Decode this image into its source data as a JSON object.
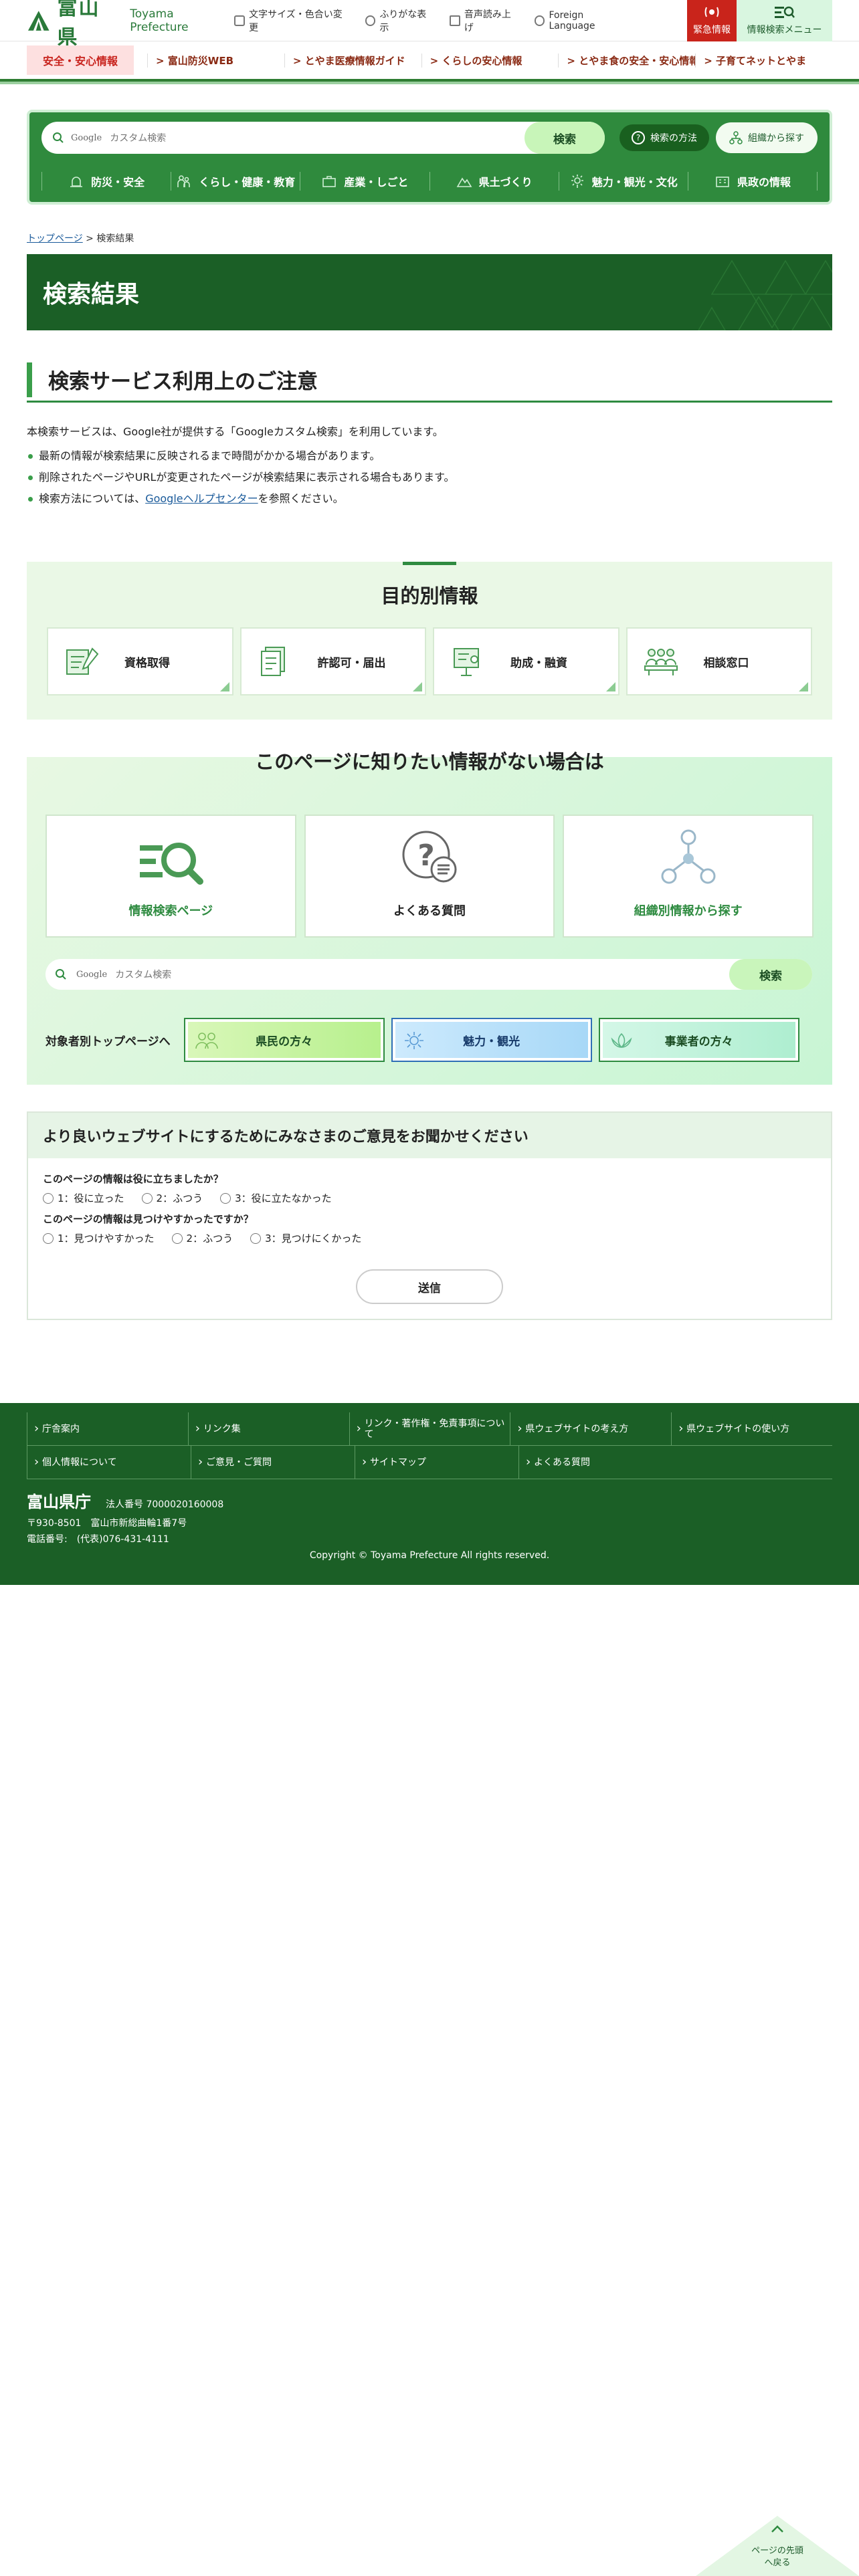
{
  "header": {
    "logo_ja": "富山県",
    "logo_en": "Toyama Prefecture",
    "utility": [
      "文字サイズ・色合い変更",
      "ふりがな表示",
      "音声読み上げ",
      "Foreign Language"
    ],
    "emergency": "緊急情報",
    "menu": "情報検索メニュー"
  },
  "safety": {
    "label": "安全・安心情報",
    "links": [
      "> 富山防災WEB",
      "> とやま医療情報ガイド",
      "> くらしの安心情報",
      "> とやま食の安全・安心情報",
      "> 子育てネットとやま"
    ]
  },
  "search": {
    "placeholder": "カスタム検索",
    "brand": "Google",
    "button": "検索",
    "howto": "検索の方法",
    "org": "組織から探す"
  },
  "gnav": [
    "防災・安全",
    "くらし・健康・教育",
    "産業・しごと",
    "県土づくり",
    "魅力・観光・文化",
    "県政の情報"
  ],
  "breadcrumb": {
    "top": "トップページ",
    "sep": " > ",
    "current": "検索結果"
  },
  "page_title": "検索結果",
  "notice": {
    "heading": "検索サービス利用上のご注意",
    "intro": "本検索サービスは、Google社が提供する「Googleカスタム検索」を利用しています。",
    "items": [
      "最新の情報が検索結果に反映されるまで時間がかかる場合があります。",
      "削除されたページやURLが変更されたページが検索結果に表示される場合もあります。"
    ],
    "help_pre": "検索方法については、",
    "help_link": "Googleヘルプセンター",
    "help_post": "を参照ください。"
  },
  "purpose": {
    "heading": "目的別情報",
    "cards": [
      "資格取得",
      "許認可・届出",
      "助成・融資",
      "相談窓口"
    ]
  },
  "notfound": {
    "heading": "このページに知りたい情報がない場合は",
    "cards": [
      "情報検索ページ",
      "よくある質問",
      "組織別情報から探す"
    ],
    "search_brand": "Google",
    "search_placeholder": "カスタム検索",
    "search_button": "検索",
    "audience_label": "対象者別トップページへ",
    "audience": [
      "県民の方々",
      "魅力・観光",
      "事業者の方々"
    ]
  },
  "feedback": {
    "heading": "より良いウェブサイトにするためにみなさまのご意見をお聞かせください",
    "q1": "このページの情報は役に立ちましたか？",
    "q1_opts": [
      "1：役に立った",
      "2：ふつう",
      "3：役に立たなかった"
    ],
    "q2": "このページの情報は見つけやすかったですか？",
    "q2_opts": [
      "1：見つけやすかった",
      "2：ふつう",
      "3：見つけにくかった"
    ],
    "send": "送信"
  },
  "footer": {
    "row1": [
      "庁舎案内",
      "リンク集",
      "リンク・著作権・免責事項について",
      "県ウェブサイトの考え方",
      "県ウェブサイトの使い方"
    ],
    "row2": [
      "個人情報について",
      "ご意見・ご質問",
      "サイトマップ",
      "よくある質問"
    ],
    "name": "富山県庁",
    "corp_no": "法人番号 7000020160008",
    "address": "〒930-8501　富山市新総曲輪1番7号",
    "phone": "電話番号:　(代表)076-431-4111",
    "copyright": "Copyright © Toyama Prefecture All rights reserved."
  },
  "pagetop": "ページの先頭へ戻る",
  "colors": {
    "brand_green": "#1b5f26",
    "accent_green": "#2f8a3d",
    "emergency_red": "#c9241b"
  }
}
